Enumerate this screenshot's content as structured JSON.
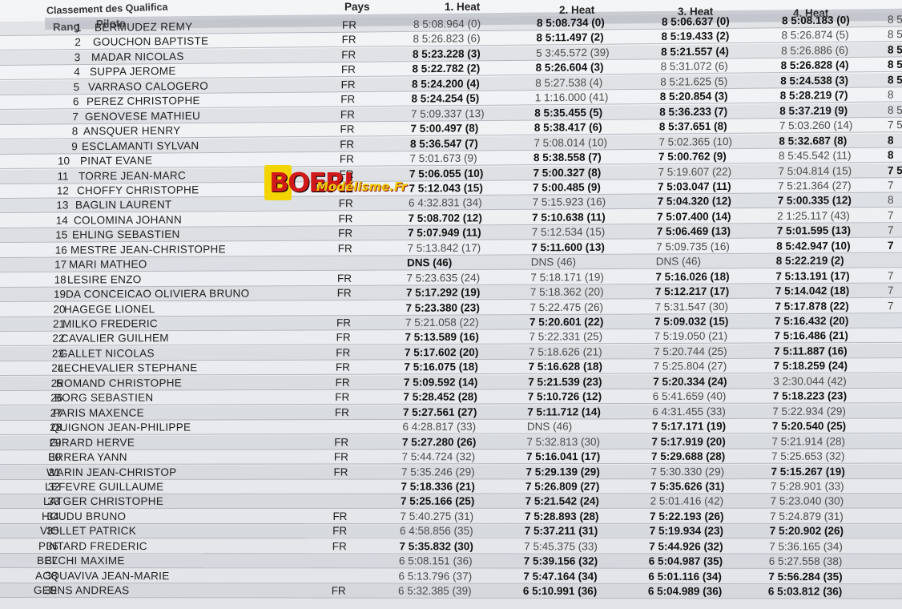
{
  "document": {
    "title": "Classement des Qualifica",
    "headers": {
      "rang": "Rang",
      "pilote": "Pilote",
      "pays": "Pays",
      "heat1": "1. Heat",
      "heat2": "2. Heat",
      "heat3": "3. Heat",
      "heat4": "4. Heat"
    },
    "watermark": "Boeri Modélisme.fr",
    "rows": [
      {
        "rang": "1",
        "pilote": "BERMUDEZ REMY",
        "pays": "FR",
        "h": [
          "8 5:08.964 (0)",
          "8 5:08.734 (0)",
          "8 5:06.637 (0)",
          "8 5:08.183 (0)",
          "8 5"
        ],
        "b": [
          0,
          1,
          1,
          1,
          0
        ]
      },
      {
        "rang": "2",
        "pilote": "GOUCHON BAPTISTE",
        "pays": "FR",
        "h": [
          "8 5:26.823 (6)",
          "8 5:11.497 (2)",
          "8 5:19.433 (2)",
          "8 5:26.874 (5)",
          "8 5"
        ],
        "b": [
          0,
          1,
          1,
          0,
          0
        ]
      },
      {
        "rang": "3",
        "pilote": "MADAR NICOLAS",
        "pays": "FR",
        "h": [
          "8 5:23.228 (3)",
          "5 3:45.572 (39)",
          "8 5:21.557 (4)",
          "8 5:26.886 (6)",
          "8 5"
        ],
        "b": [
          1,
          0,
          1,
          0,
          1
        ]
      },
      {
        "rang": "4",
        "pilote": "SUPPA JEROME",
        "pays": "FR",
        "h": [
          "8 5:22.782 (2)",
          "8 5:26.604 (3)",
          "8 5:31.072 (6)",
          "8 5:26.828 (4)",
          "8 5"
        ],
        "b": [
          1,
          1,
          0,
          1,
          1
        ]
      },
      {
        "rang": "5",
        "pilote": "VARRASO CALOGERO",
        "pays": "FR",
        "h": [
          "8 5:24.200 (4)",
          "8 5:27.538 (4)",
          "8 5:21.625 (5)",
          "8 5:24.538 (3)",
          "8 5"
        ],
        "b": [
          1,
          0,
          0,
          1,
          1
        ]
      },
      {
        "rang": "6",
        "pilote": "PEREZ CHRISTOPHE",
        "pays": "FR",
        "h": [
          "8 5:24.254 (5)",
          "1 1:16.000 (41)",
          "8 5:20.854 (3)",
          "8 5:28.219 (7)",
          "8"
        ],
        "b": [
          1,
          0,
          1,
          1,
          0
        ]
      },
      {
        "rang": "7",
        "pilote": "GENOVESE MATHIEU",
        "pays": "FR",
        "h": [
          "7 5:09.337 (13)",
          "8 5:35.455 (5)",
          "8 5:36.233 (7)",
          "8 5:37.219 (9)",
          "8 5"
        ],
        "b": [
          0,
          1,
          1,
          1,
          0
        ]
      },
      {
        "rang": "8",
        "pilote": "ANSQUER HENRY",
        "pays": "FR",
        "h": [
          "7 5:00.497 (8)",
          "8 5:38.417 (6)",
          "8 5:37.651 (8)",
          "7 5:03.260 (14)",
          "7 5"
        ],
        "b": [
          1,
          1,
          1,
          0,
          0
        ]
      },
      {
        "rang": "9",
        "pilote": "ESCLAMANTI SYLVAN",
        "pays": "FR",
        "h": [
          "8 5:36.547 (7)",
          "7 5:08.014 (10)",
          "7 5:02.365 (10)",
          "8 5:32.687 (8)",
          "8"
        ],
        "b": [
          1,
          0,
          0,
          1,
          1
        ]
      },
      {
        "rang": "10",
        "pilote": "PINAT EVANE",
        "pays": "FR",
        "h": [
          "7 5:01.673 (9)",
          "8 5:38.558 (7)",
          "7 5:00.762 (9)",
          "8 5:45.542 (11)",
          "8"
        ],
        "b": [
          0,
          1,
          1,
          0,
          1
        ]
      },
      {
        "rang": "11",
        "pilote": "TORRE JEAN-MARC",
        "pays": "FR",
        "h": [
          "7 5:06.055 (10)",
          "7 5:00.327 (8)",
          "7 5:19.607 (22)",
          "7 5:04.814 (15)",
          "7 5"
        ],
        "b": [
          1,
          1,
          0,
          0,
          1
        ]
      },
      {
        "rang": "12",
        "pilote": "CHOFFY CHRISTOPHE",
        "pays": "FR",
        "h": [
          "7 5:12.043 (15)",
          "7 5:00.485 (9)",
          "7 5:03.047 (11)",
          "7 5:21.364 (27)",
          "7"
        ],
        "b": [
          1,
          1,
          1,
          0,
          0
        ]
      },
      {
        "rang": "13",
        "pilote": "BAGLIN LAURENT",
        "pays": "FR",
        "h": [
          "6 4:32.831 (34)",
          "7 5:15.923 (16)",
          "7 5:04.320 (12)",
          "7 5:00.335 (12)",
          "8"
        ],
        "b": [
          0,
          0,
          1,
          1,
          0
        ]
      },
      {
        "rang": "14",
        "pilote": "COLOMINA JOHANN",
        "pays": "FR",
        "h": [
          "7 5:08.702 (12)",
          "7 5:10.638 (11)",
          "7 5:07.400 (14)",
          "2 1:25.117 (43)",
          "7"
        ],
        "b": [
          1,
          1,
          1,
          0,
          0
        ]
      },
      {
        "rang": "15",
        "pilote": "EHLING SEBASTIEN",
        "pays": "FR",
        "h": [
          "7 5:07.949 (11)",
          "7 5:12.534 (15)",
          "7 5:06.469 (13)",
          "7 5:01.595 (13)",
          "7"
        ],
        "b": [
          1,
          0,
          1,
          1,
          0
        ]
      },
      {
        "rang": "16",
        "pilote": "MESTRE JEAN-CHRISTOPHE",
        "pays": "FR",
        "h": [
          "7 5:13.842 (17)",
          "7 5:11.600 (13)",
          "7 5:09.735 (16)",
          "8 5:42.947 (10)",
          "7"
        ],
        "b": [
          0,
          1,
          0,
          1,
          1
        ]
      },
      {
        "rang": "17",
        "pilote": "MARI MATHEO",
        "pays": "",
        "h": [
          "DNS (46)",
          "DNS (46)",
          "DNS (46)",
          "8 5:22.219 (2)",
          ""
        ],
        "b": [
          1,
          0,
          0,
          1,
          0
        ]
      },
      {
        "rang": "18",
        "pilote": "LESIRE ENZO",
        "pays": "FR",
        "h": [
          "7 5:23.635 (24)",
          "7 5:18.171 (19)",
          "7 5:16.026 (18)",
          "7 5:13.191 (17)",
          "7"
        ],
        "b": [
          0,
          0,
          1,
          1,
          0
        ]
      },
      {
        "rang": "19",
        "pilote": "DA CONCEICAO OLIVIERA BRUNO",
        "pays": "FR",
        "h": [
          "7 5:17.292 (19)",
          "7 5:18.362 (20)",
          "7 5:12.217 (17)",
          "7 5:14.042 (18)",
          "7"
        ],
        "b": [
          1,
          0,
          1,
          1,
          0
        ]
      },
      {
        "rang": "20",
        "pilote": "HAGEGE LIONEL",
        "pays": "",
        "h": [
          "7 5:23.380 (23)",
          "7 5:22.475 (26)",
          "7 5:31.547 (30)",
          "7 5:17.878 (22)",
          "7"
        ],
        "b": [
          1,
          0,
          0,
          1,
          0
        ]
      },
      {
        "rang": "21",
        "pilote": "MILKO FREDERIC",
        "pays": "FR",
        "h": [
          "7 5:21.058 (22)",
          "7 5:20.601 (22)",
          "7 5:09.032 (15)",
          "7 5:16.432 (20)",
          ""
        ],
        "b": [
          0,
          1,
          1,
          1,
          0
        ]
      },
      {
        "rang": "22",
        "pilote": "CAVALIER GUILHEM",
        "pays": "FR",
        "h": [
          "7 5:13.589 (16)",
          "7 5:22.331 (25)",
          "7 5:19.050 (21)",
          "7 5:16.486 (21)",
          ""
        ],
        "b": [
          1,
          0,
          0,
          1,
          0
        ]
      },
      {
        "rang": "23",
        "pilote": "GALLET NICOLAS",
        "pays": "FR",
        "h": [
          "7 5:17.602 (20)",
          "7 5:18.626 (21)",
          "7 5:20.744 (25)",
          "7 5:11.887 (16)",
          ""
        ],
        "b": [
          1,
          0,
          0,
          1,
          0
        ]
      },
      {
        "rang": "24",
        "pilote": "LECHEVALIER STEPHANE",
        "pays": "FR",
        "h": [
          "7 5:16.075 (18)",
          "7 5:16.628 (18)",
          "7 5:25.804 (27)",
          "7 5:18.259 (24)",
          ""
        ],
        "b": [
          1,
          1,
          0,
          1,
          0
        ]
      },
      {
        "rang": "25",
        "pilote": "ROMAND CHRISTOPHE",
        "pays": "FR",
        "h": [
          "7 5:09.592 (14)",
          "7 5:21.539 (23)",
          "7 5:20.334 (24)",
          "3 2:30.044 (42)",
          ""
        ],
        "b": [
          1,
          1,
          1,
          0,
          0
        ]
      },
      {
        "rang": "26",
        "pilote": "BORG SEBASTIEN",
        "pays": "FR",
        "h": [
          "7 5:28.452 (28)",
          "7 5:10.726 (12)",
          "6 5:41.659 (40)",
          "7 5:18.223 (23)",
          ""
        ],
        "b": [
          1,
          1,
          0,
          1,
          0
        ]
      },
      {
        "rang": "27",
        "pilote": "PARIS MAXENCE",
        "pays": "FR",
        "h": [
          "7 5:27.561 (27)",
          "7 5:11.712 (14)",
          "6 4:31.455 (33)",
          "7 5:22.934 (29)",
          ""
        ],
        "b": [
          1,
          1,
          0,
          0,
          0
        ]
      },
      {
        "rang": "28",
        "pilote": "QUIGNON JEAN-PHILIPPE",
        "pays": "",
        "h": [
          "6 4:28.817 (33)",
          "DNS (46)",
          "7 5:17.171 (19)",
          "7 5:20.540 (25)",
          ""
        ],
        "b": [
          0,
          0,
          1,
          1,
          0
        ]
      },
      {
        "rang": "29",
        "pilote": "GIRARD HERVE",
        "pays": "FR",
        "h": [
          "7 5:27.280 (26)",
          "7 5:32.813 (30)",
          "7 5:17.919 (20)",
          "7 5:21.914 (28)",
          ""
        ],
        "b": [
          1,
          0,
          1,
          0,
          0
        ]
      },
      {
        "rang": "30",
        "pilote": "ERRERA YANN",
        "pays": "FR",
        "h": [
          "7 5:44.724 (32)",
          "7 5:16.041 (17)",
          "7 5:29.688 (28)",
          "7 5:25.653 (32)",
          ""
        ],
        "b": [
          0,
          1,
          1,
          0,
          0
        ]
      },
      {
        "rang": "31",
        "pilote": "WARIN JEAN-CHRISTOP",
        "pays": "FR",
        "h": [
          "7 5:35.246 (29)",
          "7 5:29.139 (29)",
          "7 5:30.330 (29)",
          "7 5:15.267 (19)",
          ""
        ],
        "b": [
          0,
          1,
          0,
          1,
          0
        ]
      },
      {
        "rang": "32",
        "pilote": "LEFEVRE GUILLAUME",
        "pays": "",
        "h": [
          "7 5:18.336 (21)",
          "7 5:26.809 (27)",
          "7 5:35.626 (31)",
          "7 5:28.901 (33)",
          ""
        ],
        "b": [
          1,
          1,
          1,
          0,
          0
        ]
      },
      {
        "rang": "33",
        "pilote": "LATGER CHRISTOPHE",
        "pays": "",
        "h": [
          "7 5:25.166 (25)",
          "7 5:21.542 (24)",
          "2 5:01.416 (42)",
          "7 5:23.040 (30)",
          ""
        ],
        "b": [
          1,
          1,
          0,
          0,
          0
        ]
      },
      {
        "rang": "34",
        "pilote": "HOUDU BRUNO",
        "pays": "FR",
        "h": [
          "7 5:40.275 (31)",
          "7 5:28.893 (28)",
          "7 5:22.193 (26)",
          "7 5:24.879 (31)",
          ""
        ],
        "b": [
          0,
          1,
          1,
          0,
          0
        ]
      },
      {
        "rang": "35",
        "pilote": "VIOLLET PATRICK",
        "pays": "FR",
        "h": [
          "6 4:58.856 (35)",
          "7 5:37.211 (31)",
          "7 5:19.934 (23)",
          "7 5:20.902 (26)",
          ""
        ],
        "b": [
          0,
          1,
          1,
          1,
          0
        ]
      },
      {
        "rang": "36",
        "pilote": "PINTARD FREDERIC",
        "pays": "FR",
        "h": [
          "7 5:35.832 (30)",
          "7 5:45.375 (33)",
          "7 5:44.926 (32)",
          "7 5:36.165 (34)",
          ""
        ],
        "b": [
          1,
          0,
          1,
          0,
          0
        ]
      },
      {
        "rang": "37",
        "pilote": "BELCHI MAXIME",
        "pays": "",
        "h": [
          "6 5:08.151 (36)",
          "7 5:39.156 (32)",
          "6 5:04.987 (35)",
          "6 5:27.558 (38)",
          ""
        ],
        "b": [
          0,
          1,
          1,
          0,
          0
        ]
      },
      {
        "rang": "38",
        "pilote": "ACQUAVIVA JEAN-MARIE",
        "pays": "",
        "h": [
          "6 5:13.796 (37)",
          "7 5:47.164 (34)",
          "6 5:01.116 (34)",
          "7 5:56.284 (35)",
          ""
        ],
        "b": [
          0,
          1,
          1,
          1,
          0
        ]
      },
      {
        "rang": "39",
        "pilote": "GEENS ANDREAS",
        "pays": "FR",
        "h": [
          "6 5:32.385 (39)",
          "6 5:10.991 (36)",
          "6 5:04.989 (36)",
          "6 5:03.812 (36)",
          ""
        ],
        "b": [
          0,
          1,
          1,
          1,
          0
        ]
      }
    ]
  }
}
